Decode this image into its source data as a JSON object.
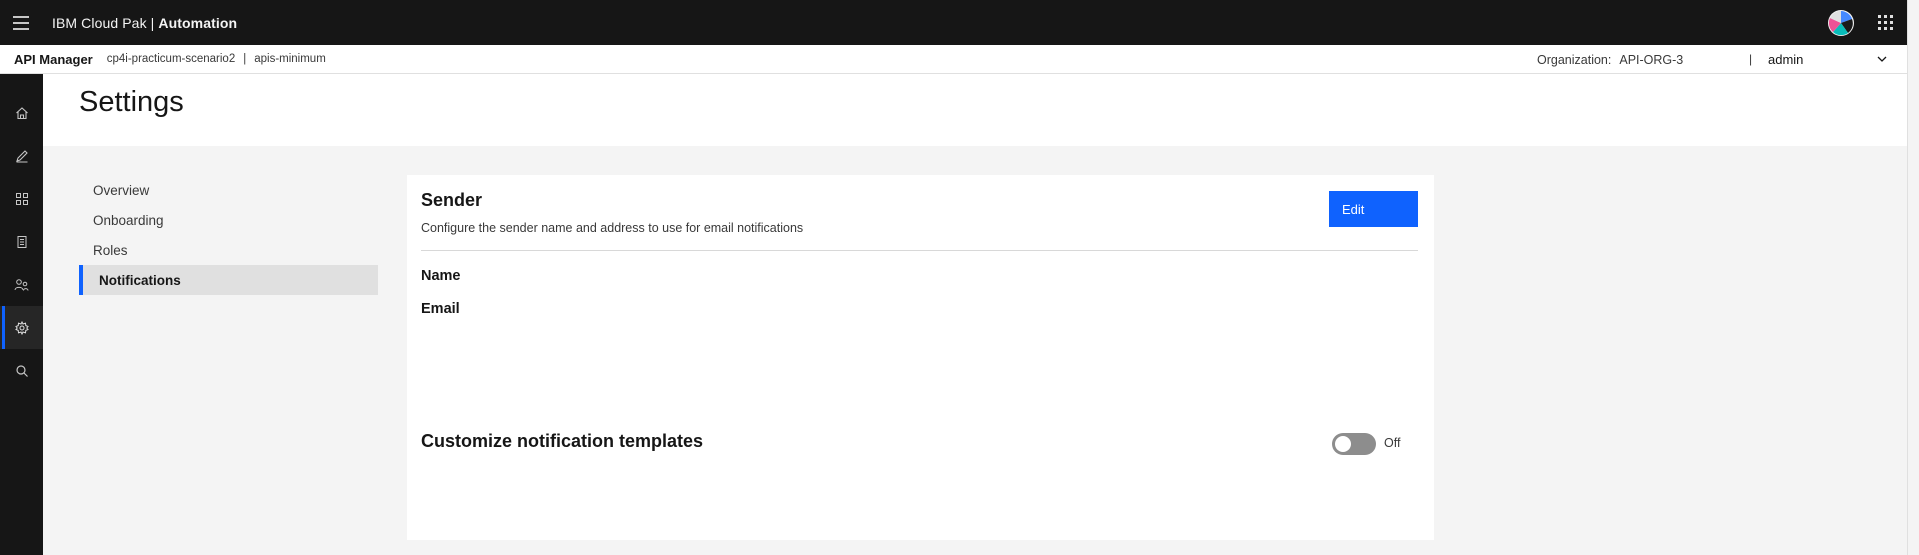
{
  "header": {
    "brand_prefix": "IBM Cloud Pak | ",
    "brand_bold": "Automation"
  },
  "subheader": {
    "app_name": "API Manager",
    "breadcrumbs": [
      "cp4i-practicum-scenario2",
      "apis-minimum"
    ],
    "crumb_separator": "|",
    "org_label": "Organization:",
    "org_value": "API-ORG-3",
    "user_separator": "|",
    "user": "admin"
  },
  "rail": {
    "items": [
      {
        "icon": "home-icon"
      },
      {
        "icon": "edit-icon"
      },
      {
        "icon": "apps-grid-icon"
      },
      {
        "icon": "catalog-icon"
      },
      {
        "icon": "members-icon"
      },
      {
        "icon": "settings-icon",
        "active": true
      },
      {
        "icon": "search-icon"
      }
    ]
  },
  "page": {
    "title": "Settings"
  },
  "settings_nav": {
    "items": [
      {
        "label": "Overview"
      },
      {
        "label": "Onboarding"
      },
      {
        "label": "Roles"
      },
      {
        "label": "Notifications",
        "active": true
      }
    ]
  },
  "sender": {
    "title": "Sender",
    "description": "Configure the sender name and address to use for email notifications",
    "edit_label": "Edit",
    "name_label": "Name",
    "email_label": "Email"
  },
  "templates": {
    "title": "Customize notification templates",
    "toggle_state": "Off"
  },
  "colors": {
    "accent": "#0f62fe",
    "header_bg": "#161616",
    "page_bg": "#f4f4f4"
  }
}
